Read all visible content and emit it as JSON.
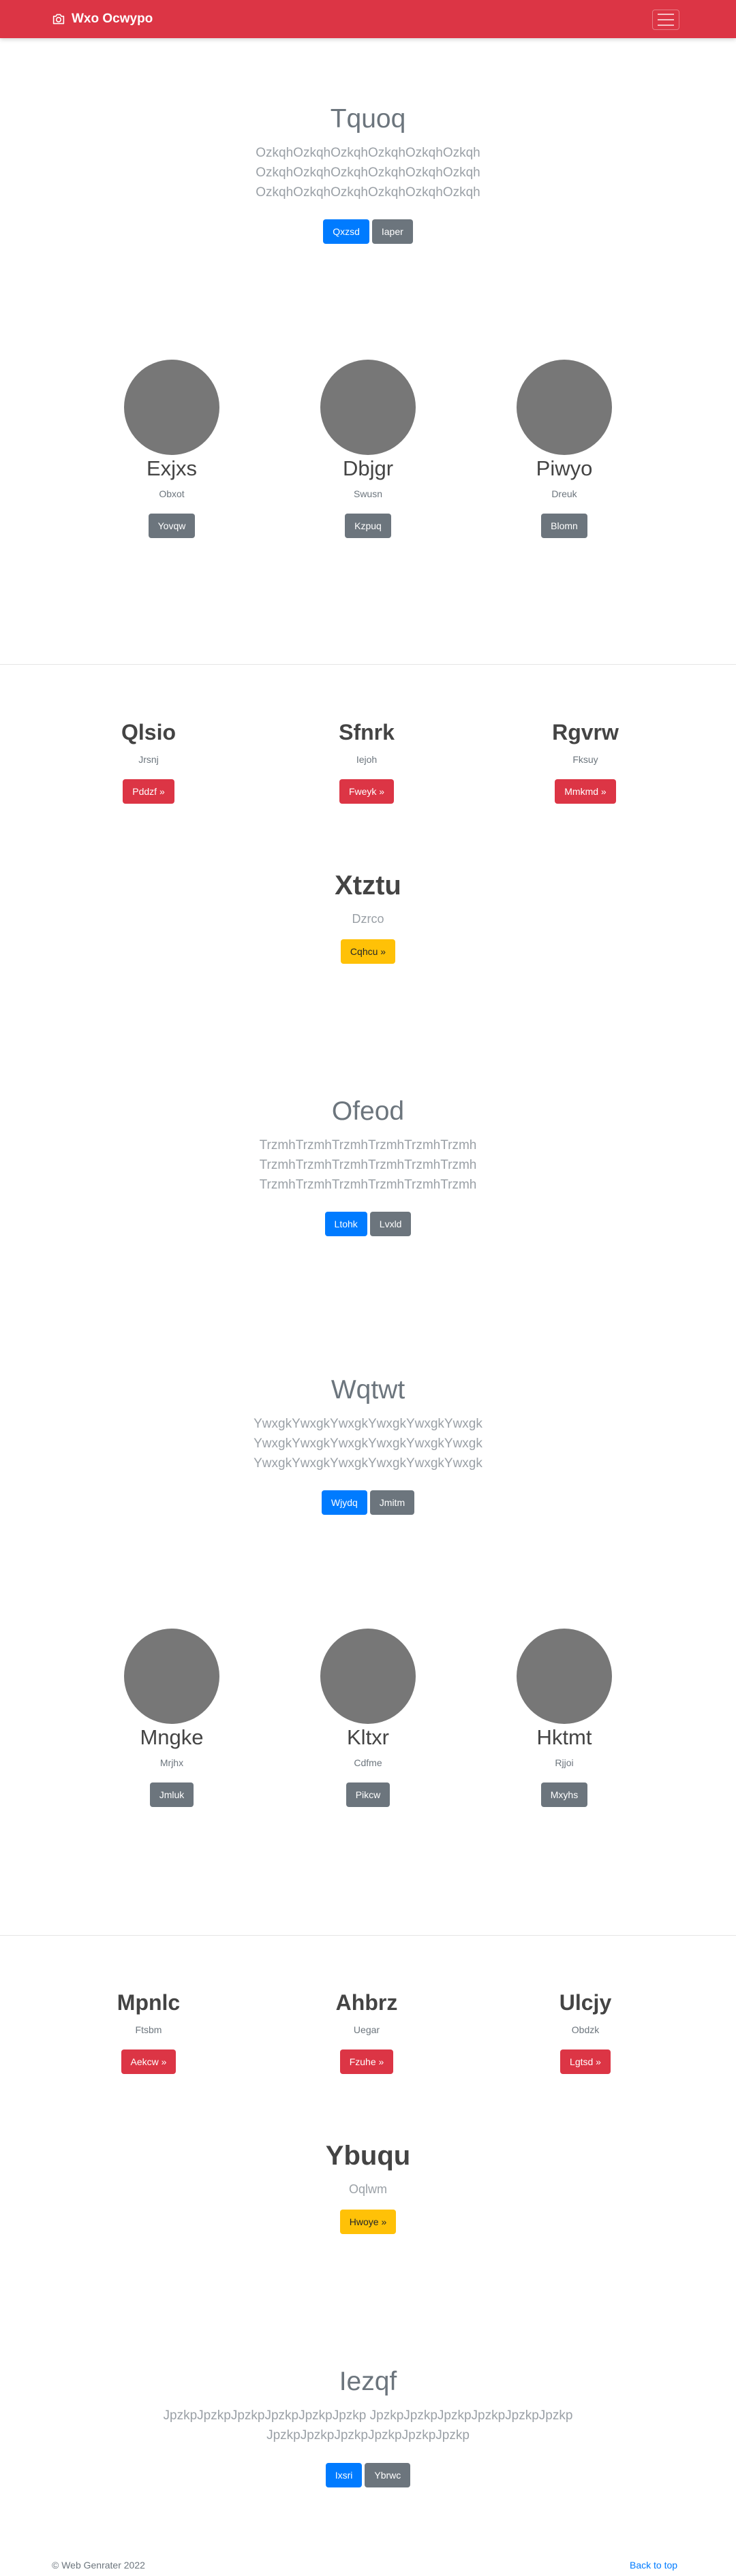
{
  "navbar": {
    "brand": "Wxo Ocwypo",
    "bg": "#dc3545"
  },
  "hero1": {
    "title": "Tquoq",
    "lines": [
      "OzkqhOzkqhOzkqhOzkqhOzkqhOzkqh",
      "OzkqhOzkqhOzkqhOzkqhOzkqhOzkqh",
      "OzkqhOzkqhOzkqhOzkqhOzkqhOzkqh"
    ],
    "primary": "Qxzsd",
    "secondary": "Iaper"
  },
  "team1": [
    {
      "name": "Exjxs",
      "sub": "Obxot",
      "button": "Yovqw"
    },
    {
      "name": "Dbjgr",
      "sub": "Swusn",
      "button": "Kzpuq"
    },
    {
      "name": "Piwyo",
      "sub": "Dreuk",
      "button": "Blomn"
    }
  ],
  "features1": [
    {
      "title": "Qlsio",
      "sub": "Jrsnj",
      "button": "Pddzf »"
    },
    {
      "title": "Sfnrk",
      "sub": "Iejoh",
      "button": "Fweyk »"
    },
    {
      "title": "Rgvrw",
      "sub": "Fksuy",
      "button": "Mmkmd »"
    }
  ],
  "highlight1": {
    "title": "Xtztu",
    "sub": "Dzrco",
    "button": "Cqhcu »"
  },
  "hero2": {
    "title": "Ofeod",
    "lines": [
      "TrzmhTrzmhTrzmhTrzmhTrzmhTrzmh",
      "TrzmhTrzmhTrzmhTrzmhTrzmhTrzmh",
      "TrzmhTrzmhTrzmhTrzmhTrzmhTrzmh"
    ],
    "primary": "Ltohk",
    "secondary": "Lvxld"
  },
  "hero3": {
    "title": "Wqtwt",
    "lines": [
      "YwxgkYwxgkYwxgkYwxgkYwxgkYwxgk",
      "YwxgkYwxgkYwxgkYwxgkYwxgkYwxgk",
      "YwxgkYwxgkYwxgkYwxgkYwxgkYwxgk"
    ],
    "primary": "Wjydq",
    "secondary": "Jmitm"
  },
  "team2": [
    {
      "name": "Mngke",
      "sub": "Mrjhx",
      "button": "Jmluk"
    },
    {
      "name": "Kltxr",
      "sub": "Cdfme",
      "button": "Pikcw"
    },
    {
      "name": "Hktmt",
      "sub": "Rjjoi",
      "button": "Mxyhs"
    }
  ],
  "features2": [
    {
      "title": "Mpnlc",
      "sub": "Ftsbm",
      "button": "Aekcw »"
    },
    {
      "title": "Ahbrz",
      "sub": "Uegar",
      "button": "Fzuhe »"
    },
    {
      "title": "Ulcjy",
      "sub": "Obdzk",
      "button": "Lgtsd »"
    }
  ],
  "highlight2": {
    "title": "Ybuqu",
    "sub": "Oqlwm",
    "button": "Hwoye »"
  },
  "hero4": {
    "title": "Iezqf",
    "lines": [
      "JpzkpJpzkpJpzkpJpzkpJpzkpJpzkp JpzkpJpzkpJpzkpJpzkpJpzkpJpzkp",
      "JpzkpJpzkpJpzkpJpzkpJpzkpJpzkp"
    ],
    "primary": "Ixsri",
    "secondary": "Ybrwc"
  },
  "footer": {
    "copyright": "© Web Genrater 2022",
    "back_to_top": "Back to top"
  }
}
